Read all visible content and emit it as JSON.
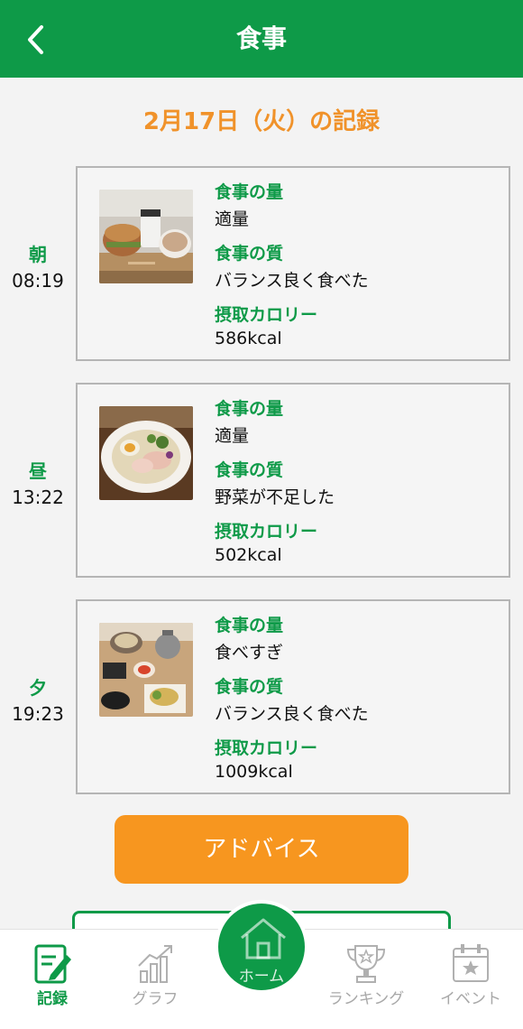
{
  "header": {
    "title": "食事",
    "back_icon": "chevron-left-icon"
  },
  "date_title": "2月17日（火）の記録",
  "meals": [
    {
      "label": "朝",
      "time": "08:19",
      "amount_label": "食事の量",
      "amount": "適量",
      "quality_label": "食事の質",
      "quality": "バランス良く食べた",
      "calorie_label": "摂取カロリー",
      "calories": "586kcal"
    },
    {
      "label": "昼",
      "time": "13:22",
      "amount_label": "食事の量",
      "amount": "適量",
      "quality_label": "食事の質",
      "quality": "野菜が不足した",
      "calorie_label": "摂取カロリー",
      "calories": "502kcal"
    },
    {
      "label": "夕",
      "time": "19:23",
      "amount_label": "食事の量",
      "amount": "食べすぎ",
      "quality_label": "食事の質",
      "quality": "バランス良く食べた",
      "calorie_label": "摂取カロリー",
      "calories": "1009kcal"
    }
  ],
  "advice_button": "アドバイス",
  "nav": {
    "items": [
      {
        "label": "記録",
        "icon": "record-icon",
        "active": true
      },
      {
        "label": "グラフ",
        "icon": "graph-icon",
        "active": false
      },
      {
        "label": "ホーム",
        "icon": "home-icon",
        "active": false
      },
      {
        "label": "ランキング",
        "icon": "trophy-icon",
        "active": false
      },
      {
        "label": "イベント",
        "icon": "calendar-icon",
        "active": false
      }
    ]
  },
  "colors": {
    "brand_green": "#0e9a48",
    "accent_orange": "#f7961f",
    "date_orange": "#f0922a"
  }
}
